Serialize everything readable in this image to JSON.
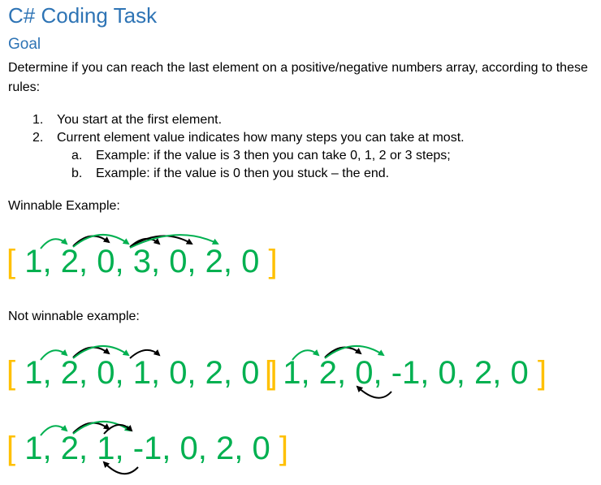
{
  "title": "C# Coding Task",
  "subtitle": "Goal",
  "intro": "Determine if you can reach the last element on a positive/negative numbers array, according to these rules:",
  "rules": [
    {
      "num": "1.",
      "text": "You start at the first element."
    },
    {
      "num": "2.",
      "text": "Current element value indicates how many steps you can take at most."
    },
    {
      "num": "a.",
      "text": "Example: if the value is 3 then you can take 0, 1, 2 or 3 steps;"
    },
    {
      "num": "b.",
      "text": "Example: if the value is 0 then you stuck – the end."
    }
  ],
  "winnable_label": "Winnable Example:",
  "not_winnable_label": "Not winnable example:",
  "arrays": {
    "winnable": {
      "open": "[",
      "close": "]",
      "elements": [
        "1,",
        "2,",
        "0,",
        "3,",
        "0,",
        "2,",
        "0"
      ]
    },
    "not_winnable_1": {
      "open": "[",
      "close": "]",
      "elements": [
        "1,",
        "2,",
        "0,",
        "1,",
        "0,",
        "2,",
        "0"
      ]
    },
    "not_winnable_2": {
      "open": "[",
      "close": "]",
      "elements": [
        "1,",
        "2,",
        "0,",
        "-1,",
        "0,",
        "2,",
        "0"
      ]
    },
    "not_winnable_3": {
      "open": "[",
      "close": "]",
      "elements": [
        "1,",
        "2,",
        "1,",
        "-1,",
        "0,",
        "2,",
        "0"
      ]
    }
  },
  "colors": {
    "heading": "#2e74b5",
    "bracket": "#ffc000",
    "element": "#00b050",
    "arrow_green": "#00b050",
    "arrow_black": "#000000"
  }
}
